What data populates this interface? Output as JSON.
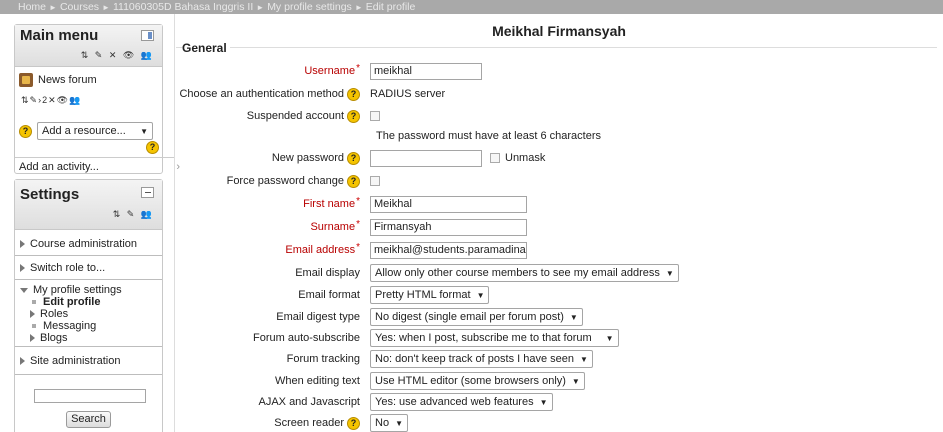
{
  "breadcrumb": [
    "Home",
    "Courses",
    "111060305D Bahasa Inggris II",
    "My profile settings",
    "Edit profile"
  ],
  "main_menu": {
    "title": "Main menu",
    "edit_icons": "⇅ ✎ ✕ 👁 👥",
    "news_forum": "News forum",
    "news_icons": "⇅✎›2✕👁👥",
    "add_resource": "Add a resource...",
    "add_activity": "Add an activity...",
    "add_activity_rest": "›"
  },
  "settings": {
    "title": "Settings",
    "edit_icons": "⇅ ✎ 👥",
    "course_admin": "Course administration",
    "switch_role": "Switch role to...",
    "my_profile": "My profile settings",
    "edit_profile": "Edit profile",
    "roles": "Roles",
    "messaging": "Messaging",
    "blogs": "Blogs",
    "site_admin": "Site administration",
    "search_button": "Search"
  },
  "profile": {
    "name": "Meikhal Firmansyah",
    "legend": "General",
    "password_note": "The password must have at least 6 characters"
  },
  "fields": {
    "username": {
      "label": "Username",
      "value": "meikhal"
    },
    "auth": {
      "label": "Choose an authentication method",
      "value": "RADIUS server"
    },
    "suspended": {
      "label": "Suspended account"
    },
    "newpass": {
      "label": "New password",
      "unmask": "Unmask"
    },
    "forcepass": {
      "label": "Force password change"
    },
    "firstname": {
      "label": "First name",
      "value": "Meikhal"
    },
    "surname": {
      "label": "Surname",
      "value": "Firmansyah"
    },
    "email": {
      "label": "Email address",
      "value": "meikhal@students.paramadina.ac"
    },
    "email_display": {
      "label": "Email display",
      "value": "Allow only other course members to see my email address"
    },
    "email_format": {
      "label": "Email format",
      "value": "Pretty HTML format"
    },
    "email_digest": {
      "label": "Email digest type",
      "value": "No digest (single email per forum post)"
    },
    "autosub": {
      "label": "Forum auto-subscribe",
      "value": "Yes: when I post, subscribe me to that forum"
    },
    "tracking": {
      "label": "Forum tracking",
      "value": "No: don't keep track of posts I have seen"
    },
    "editing": {
      "label": "When editing text",
      "value": "Use HTML editor (some browsers only)"
    },
    "ajax": {
      "label": "AJAX and Javascript",
      "value": "Yes: use advanced web features"
    },
    "screenreader": {
      "label": "Screen reader",
      "value": "No"
    }
  },
  "colors": {
    "required_label": "#b80000",
    "breadcrumb_bar": "#a9a9a9",
    "help_icon": "#f5c400"
  }
}
